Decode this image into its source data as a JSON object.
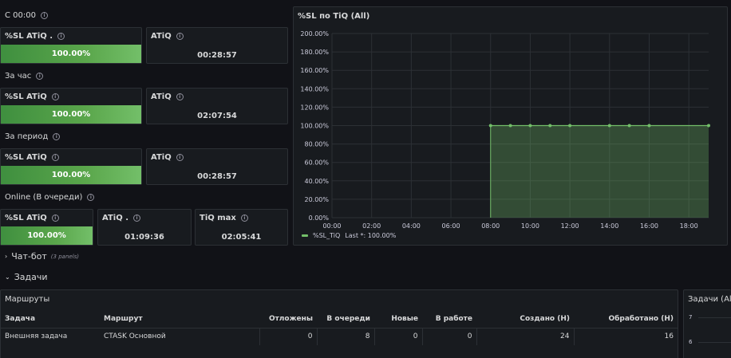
{
  "sections": {
    "since_midnight": "С 00:00",
    "per_hour": "За час",
    "per_period": "За период",
    "online": "Online (В очереди)"
  },
  "stats": {
    "r1_sl_title": "%SL ATiQ .",
    "r1_sl_value": "100.00%",
    "r1_atiq_title": "ATiQ",
    "r1_atiq_value": "00:28:57",
    "r2_sl_title": "%SL ATiQ",
    "r2_sl_value": "100.00%",
    "r2_atiq_title": "ATiQ",
    "r2_atiq_value": "02:07:54",
    "r3_sl_title": "%SL ATiQ",
    "r3_sl_value": "100.00%",
    "r3_atiq_title": "ATiQ",
    "r3_atiq_value": "00:28:57",
    "r4_sl_title": "%SL ATiQ",
    "r4_sl_value": "100.00%",
    "r4_atiq_title": "ATiQ .",
    "r4_atiq_value": "01:09:36",
    "r4_tiq_title": "TiQ max",
    "r4_tiq_value": "02:05:41"
  },
  "chart_panel": {
    "title": "%SL по TiQ (All)",
    "legend_label": "%SL_TiQ",
    "legend_last": "Last *: 100.00%",
    "series_color": "#73bf69"
  },
  "chart_data": {
    "type": "area",
    "title": "%SL по TiQ (All)",
    "x_ticks": [
      "00:00",
      "02:00",
      "04:00",
      "06:00",
      "08:00",
      "10:00",
      "12:00",
      "14:00",
      "16:00",
      "18:00"
    ],
    "y_ticks": [
      "0.00%",
      "20.00%",
      "40.00%",
      "60.00%",
      "80.00%",
      "100.00%",
      "120.00%",
      "140.00%",
      "160.00%",
      "180.00%",
      "200.00%"
    ],
    "ylim": [
      0,
      200
    ],
    "xlim_hours": [
      0,
      19
    ],
    "series": [
      {
        "name": "%SL_TiQ",
        "x_hours": [
          8,
          9,
          10,
          11,
          12,
          14,
          15,
          16,
          19
        ],
        "values": [
          100,
          100,
          100,
          100,
          100,
          100,
          100,
          100,
          100
        ]
      }
    ],
    "legend": "bottom-left",
    "grid": true
  },
  "rows": {
    "chatbot": "Чат-бот",
    "chatbot_count": "(3 panels)",
    "tasks": "Задачи"
  },
  "routes_table": {
    "title": "Маршруты",
    "columns": [
      "Задача",
      "Маршрут",
      "Отложены",
      "В очереди",
      "Новые",
      "В работе",
      "Создано (Н)",
      "Обработано (Н)"
    ],
    "rows": [
      [
        "Внешняя задача",
        "CTASK Основной",
        "0",
        "8",
        "0",
        "0",
        "24",
        "16"
      ]
    ]
  },
  "tasks_panel": {
    "title": "Задачи (All)",
    "y_ticks": [
      "7",
      "6"
    ]
  }
}
